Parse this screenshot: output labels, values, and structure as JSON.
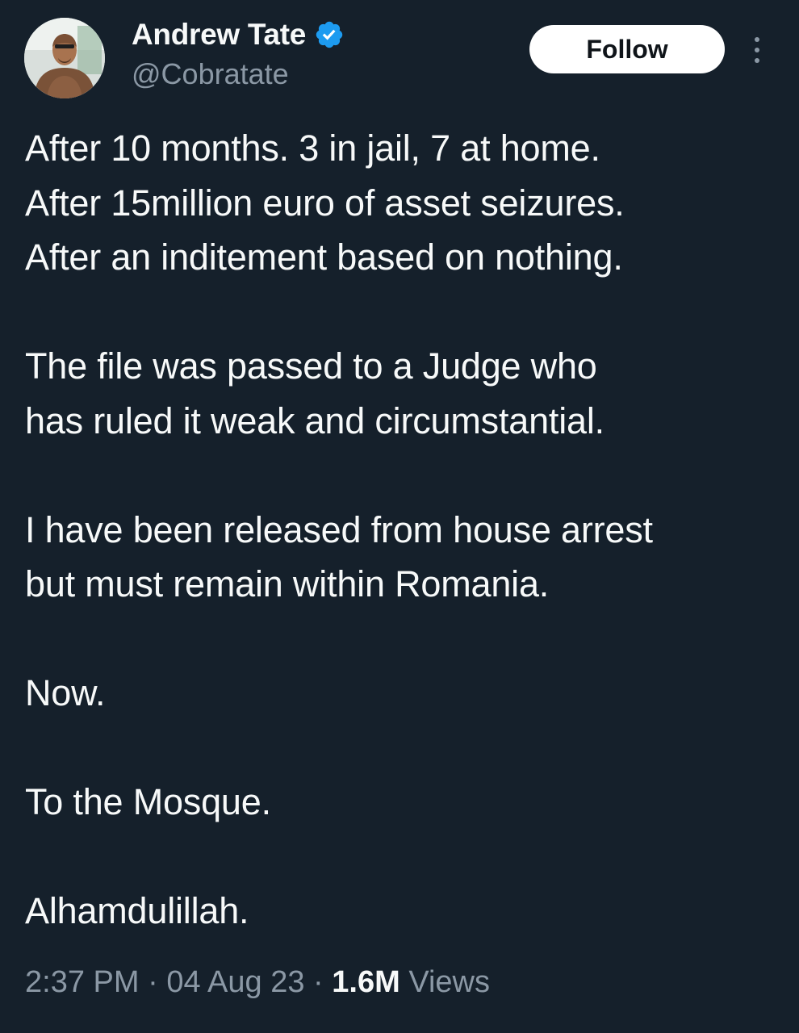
{
  "author": {
    "display_name": "Andrew Tate",
    "handle": "@Cobratate",
    "verified": true
  },
  "actions": {
    "follow_label": "Follow"
  },
  "tweet": {
    "paragraphs": [
      [
        "After 10 months. 3 in jail, 7 at home.",
        "After 15million euro of asset seizures.",
        "After an inditement based on nothing."
      ],
      [
        "The file was passed to a Judge who",
        "has ruled it weak and circumstantial."
      ],
      [
        "I have been released from house arrest",
        "but must remain within Romania."
      ],
      [
        "Now."
      ],
      [
        "To the Mosque."
      ],
      [
        "Alhamdulillah."
      ]
    ]
  },
  "meta": {
    "time": "2:37 PM",
    "separator": "·",
    "date": "04 Aug 23",
    "views_count": "1.6M",
    "views_label": "Views"
  },
  "colors": {
    "background": "#15202b",
    "text": "#f7f9f9",
    "secondary": "#8b98a5",
    "verified_badge": "#1d9bf0"
  }
}
